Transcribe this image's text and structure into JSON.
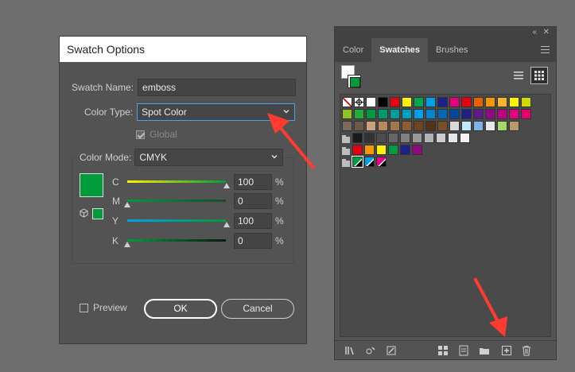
{
  "dialog": {
    "title": "Swatch Options",
    "swatch_name_label": "Swatch Name:",
    "swatch_name_value": "emboss",
    "color_type_label": "Color Type:",
    "color_type_value": "Spot Color",
    "global_label": "Global",
    "color_mode_label": "Color Mode:",
    "color_mode_value": "CMYK",
    "swatch_color": "#009c3b",
    "sliders": [
      {
        "label": "C",
        "value": "100",
        "unit": "%",
        "level": 1.0
      },
      {
        "label": "M",
        "value": "0",
        "unit": "%",
        "level": 0.0
      },
      {
        "label": "Y",
        "value": "100",
        "unit": "%",
        "level": 1.0
      },
      {
        "label": "K",
        "value": "0",
        "unit": "%",
        "level": 0.0
      }
    ],
    "preview_label": "Preview",
    "ok_label": "OK",
    "cancel_label": "Cancel"
  },
  "panel": {
    "tabs": [
      {
        "label": "Color",
        "active": false
      },
      {
        "label": "Swatches",
        "active": true
      },
      {
        "label": "Brushes",
        "active": false
      }
    ],
    "collapse_icon": "double-chevron-icon",
    "close_icon": "close-icon",
    "menu_icon": "panel-menu-icon",
    "accent_arrow_color": "#ff3b30",
    "swatch_rows": [
      [
        "none",
        "registration",
        "#ffffff",
        "#000000",
        "#e60012",
        "#fff100",
        "#00a650",
        "#00a0e9",
        "#1d2088",
        "#e4007f",
        "#e60012",
        "#eb6100",
        "#f39800",
        "#f8b62d",
        "#fff100",
        "#cfdb00"
      ],
      [
        "#8fc31f",
        "#22ac38",
        "#009944",
        "#009b6b",
        "#009e96",
        "#00a0c1",
        "#00a0e9",
        "#0086d1",
        "#0068b7",
        "#00479d",
        "#1d2088",
        "#601986",
        "#920783",
        "#be0081",
        "#e4007f",
        "#e5006a"
      ],
      [
        "#7f6a5a",
        "#6b5a4c",
        "#c7a27c",
        "#b68a5a",
        "#a0784f",
        "#8a5f35",
        "#6e4421",
        "#553116",
        "#7a4e2c",
        "#d9d9d9",
        "#bfe8ff",
        "#7fb2e6",
        "#e8e8e8",
        "#a5d86a",
        "#b89a6a"
      ],
      [
        "#1a1a1a",
        "#333333",
        "#4d4d4d",
        "#666666",
        "#808080",
        "#999999",
        "#b3b3b3",
        "#cccccc",
        "#e6e6e6",
        "#f2f2f2"
      ],
      [
        "#e60012",
        "#f39800",
        "#fff100",
        "#009944",
        "#1d2088",
        "#920783"
      ],
      [
        "#009c3b",
        "#00a0e9",
        "#e4007f"
      ]
    ],
    "bottom_icons": [
      "swatch-libraries-icon",
      "place-swatch-icon",
      "swatch-options-icon",
      "color-group-icon",
      "edit-color-group-icon",
      "new-color-group-icon",
      "new-swatch-icon",
      "delete-swatch-icon"
    ]
  }
}
